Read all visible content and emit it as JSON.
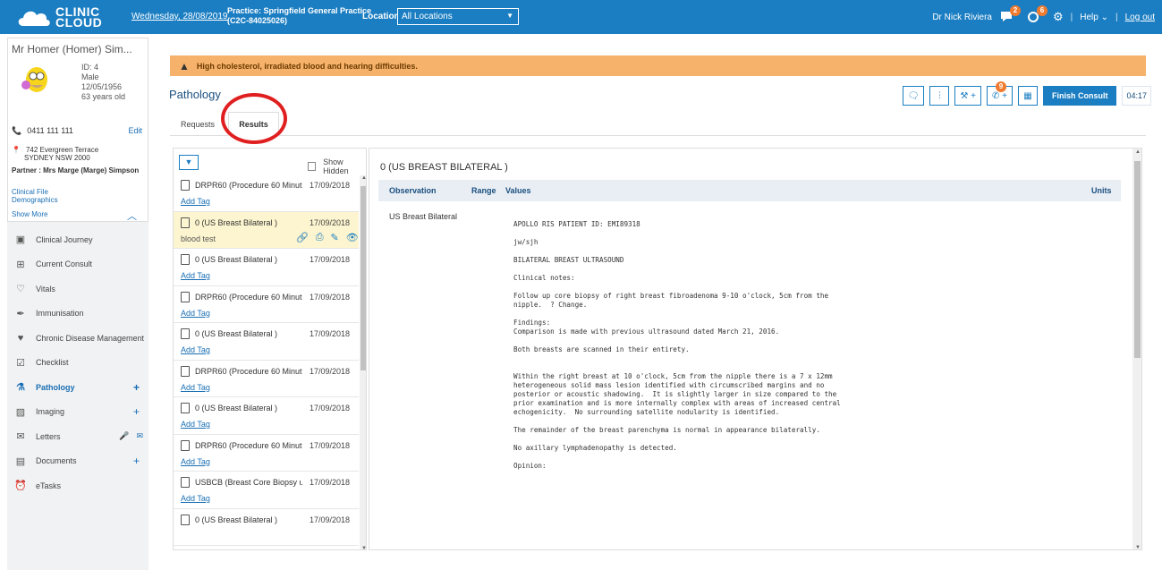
{
  "topbar": {
    "logo_line1": "CLINIC",
    "logo_line2": "CLOUD",
    "date": "Wednesday, 28/08/2019",
    "practice_line1": "Practice: Springfield General Practice",
    "practice_line2": "(C2C-84025026)",
    "location_label": "Location:",
    "location_value": "All Locations",
    "user": "Dr Nick Riviera",
    "messages_badge": "2",
    "tasks_badge": "6",
    "help": "Help",
    "logout": "Log out",
    "accent": "#1b7ec2"
  },
  "patient": {
    "name": "Mr Homer (Homer) Sim...",
    "id": "ID: 4",
    "gender": "Male",
    "dob": "12/05/1956",
    "age": "63 years old",
    "phone": "0411 111 111",
    "edit": "Edit",
    "address_line1": "742 Evergreen Terrace",
    "address_line2": "SYDNEY NSW 2000",
    "partner": "Partner : Mrs Marge (Marge) Simpson",
    "clinical_file": "Clinical File",
    "demographics": "Demographics",
    "show_more": "Show More"
  },
  "nav": {
    "items": [
      {
        "label": "Clinical Journey",
        "icon": "film-icon"
      },
      {
        "label": "Current Consult",
        "icon": "medical-kit-icon"
      },
      {
        "label": "Vitals",
        "icon": "heart-icon"
      },
      {
        "label": "Immunisation",
        "icon": "syringe-icon"
      },
      {
        "label": "Chronic Disease Management",
        "icon": "heartbeat-icon"
      },
      {
        "label": "Checklist",
        "icon": "checklist-icon"
      },
      {
        "label": "Pathology",
        "icon": "flask-icon"
      },
      {
        "label": "Imaging",
        "icon": "image-icon"
      },
      {
        "label": "Letters",
        "icon": "envelope-icon"
      },
      {
        "label": "Documents",
        "icon": "document-icon"
      },
      {
        "label": "eTasks",
        "icon": "alarm-clock-icon"
      }
    ]
  },
  "alert": {
    "text": "High cholesterol, irradiated blood and hearing difficulties.",
    "color": "#f6b26b"
  },
  "page": {
    "title": "Pathology",
    "finish_consult": "Finish Consult",
    "timer": "04:17",
    "phone_badge": "9",
    "tabs": [
      "Requests",
      "Results"
    ]
  },
  "results": {
    "show_hidden": "Show Hidden",
    "items": [
      {
        "title": "DRPR60 (Procedure 60 Minut...",
        "date": "17/09/2018",
        "tag": "Add Tag"
      },
      {
        "title": "0 (US Breast Bilateral )",
        "date": "17/09/2018",
        "tag": "blood test"
      },
      {
        "title": "0 (US Breast Bilateral )",
        "date": "17/09/2018",
        "tag": "Add Tag"
      },
      {
        "title": "DRPR60 (Procedure 60 Minut...",
        "date": "17/09/2018",
        "tag": "Add Tag"
      },
      {
        "title": "0 (US Breast Bilateral )",
        "date": "17/09/2018",
        "tag": "Add Tag"
      },
      {
        "title": "DRPR60 (Procedure 60 Minut...",
        "date": "17/09/2018",
        "tag": "Add Tag"
      },
      {
        "title": "0 (US Breast Bilateral )",
        "date": "17/09/2018",
        "tag": "Add Tag"
      },
      {
        "title": "DRPR60 (Procedure 60 Minut...",
        "date": "17/09/2018",
        "tag": "Add Tag"
      },
      {
        "title": "USBCB (Breast Core Biopsy u...",
        "date": "17/09/2018",
        "tag": "Add Tag"
      },
      {
        "title": "0 (US Breast Bilateral )",
        "date": "17/09/2018",
        "tag": ""
      }
    ]
  },
  "detail": {
    "title": "0 (US BREAST BILATERAL )",
    "col_observation": "Observation",
    "col_range": "Range",
    "col_values": "Values",
    "col_units": "Units",
    "observation_name": "US Breast Bilateral",
    "report_text": "APOLLO RIS PATIENT ID: EMI89318\n\njw/sjh\n\nBILATERAL BREAST ULTRASOUND\n\nClinical notes:\n\nFollow up core biopsy of right breast fibroadenoma 9-10 o'clock, 5cm from the\nnipple.  ? Change.\n\nFindings:\nComparison is made with previous ultrasound dated March 21, 2016.\n\nBoth breasts are scanned in their entirety.\n\n\nWithin the right breast at 10 o'clock, 5cm from the nipple there is a 7 x 12mm\nheterogeneous solid mass lesion identified with circumscribed margins and no\nposterior or acoustic shadowing.  It is slightly larger in size compared to the\nprior examination and is more internally complex with areas of increased central\nechogenicity.  No surrounding satellite nodularity is identified.\n\nThe remainder of the breast parenchyma is normal in appearance bilaterally.\n\nNo axillary lymphadenopathy is detected.\n\nOpinion:"
  }
}
